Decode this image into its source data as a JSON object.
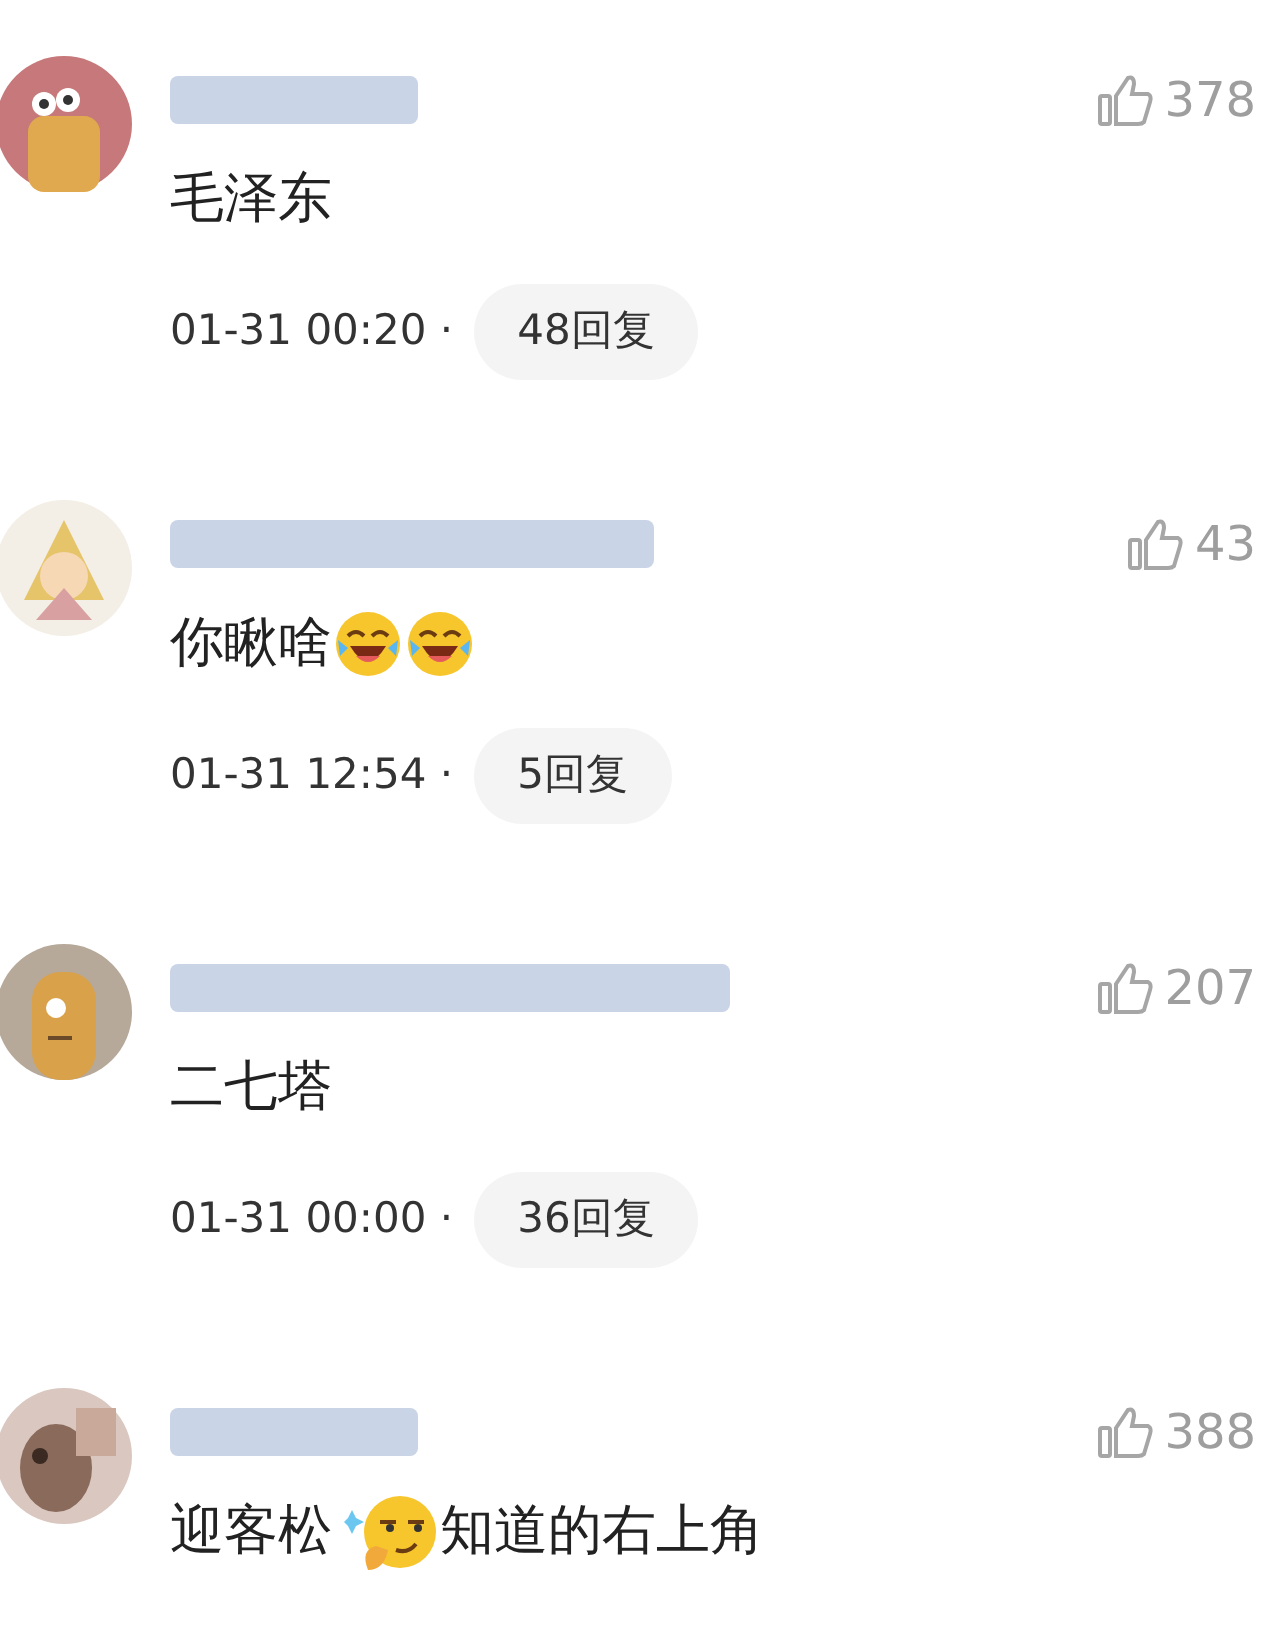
{
  "comments": [
    {
      "username": {
        "redacted": true
      },
      "likes": "378",
      "body": [
        {
          "kind": "text",
          "text": "毛泽东"
        }
      ],
      "time": "01-31 00:20 ·",
      "replies": "48回复"
    },
    {
      "username": {
        "redacted": true
      },
      "likes": "43",
      "body": [
        {
          "kind": "text",
          "text": "你瞅啥"
        },
        {
          "kind": "laugh_emoji"
        },
        {
          "kind": "laugh_emoji"
        }
      ],
      "time": "01-31 12:54 ·",
      "replies": "5回复"
    },
    {
      "username": {
        "redacted": true
      },
      "likes": "207",
      "body": [
        {
          "kind": "text",
          "text": "二七塔"
        }
      ],
      "time": "01-31 00:00 ·",
      "replies": "36回复"
    },
    {
      "username": {
        "redacted": true
      },
      "likes": "388",
      "body": [
        {
          "kind": "text",
          "text": "迎客松"
        },
        {
          "kind": "smirk_emoji"
        },
        {
          "kind": "text",
          "text": "知道的右上角"
        }
      ]
    }
  ]
}
